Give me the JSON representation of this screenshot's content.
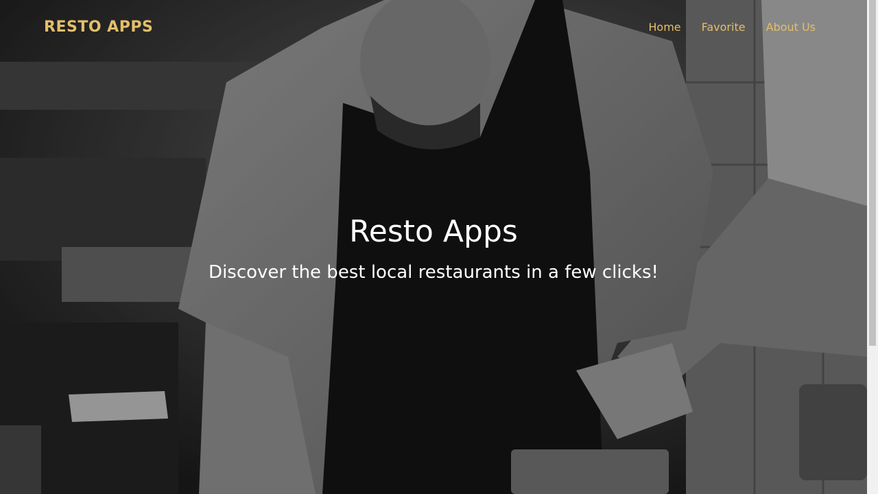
{
  "navbar": {
    "brand": "RESTO APPS",
    "links": [
      {
        "label": "Home"
      },
      {
        "label": "Favorite"
      },
      {
        "label": "About Us"
      }
    ]
  },
  "hero": {
    "title": "Resto Apps",
    "tagline": "Discover the best local restaurants in a few clicks!",
    "image_icon": "chef-cooking-photo"
  },
  "colors": {
    "accent": "#e3bf6a",
    "hero_text": "#ffffff",
    "overlay": "#000000"
  },
  "scrollbar": {
    "visible_fraction": 0.7
  }
}
